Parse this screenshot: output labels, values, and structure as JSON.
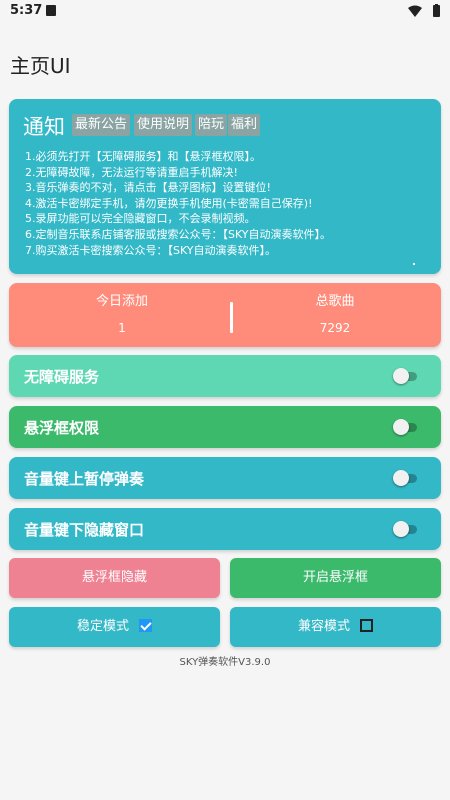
{
  "status_bar": {
    "time": "5:37",
    "icons": [
      "notification-square-icon",
      "wifi-icon",
      "battery-icon"
    ]
  },
  "page": {
    "title": "主页UI"
  },
  "notice": {
    "title": "通知",
    "tags": [
      "最新公告",
      "使用说明",
      "陪玩",
      "福利"
    ],
    "lines": [
      "1.必须先打开【无障碍服务】和【悬浮框权限】。",
      "2.无障碍故障，无法运行等请重启手机解决!",
      "3.音乐弹奏的不对，请点击【悬浮图标】设置键位!",
      "4.激活卡密绑定手机，请勿更换手机使用(卡密需自己保存)!",
      "5.录屏功能可以完全隐藏窗口，不会录制视频。",
      "6.定制音乐联系店铺客服或搜索公众号：【SKY自动演奏软件】。",
      "7.购买激活卡密搜索公众号：【SKY自动演奏软件】。"
    ],
    "color": "#33b8c8"
  },
  "stats": {
    "today_label": "今日添加",
    "today_value": "1",
    "total_label": "总歌曲",
    "total_value": "7292",
    "color": "#ff8b7a"
  },
  "toggles": [
    {
      "label": "无障碍服务",
      "on": false,
      "color": "#5ed8b2"
    },
    {
      "label": "悬浮框权限",
      "on": false,
      "color": "#3cba6c"
    },
    {
      "label": "音量键上暂停弹奏",
      "on": false,
      "color": "#33b8c8"
    },
    {
      "label": "音量键下隐藏窗口",
      "on": false,
      "color": "#33b8c8"
    }
  ],
  "buttons": {
    "hide_float": "悬浮框隐藏",
    "open_float": "开启悬浮框",
    "stable_mode": "稳定模式",
    "stable_checked": true,
    "compat_mode": "兼容模式",
    "compat_checked": false
  },
  "colors": {
    "hide_btn": "#ee8293",
    "open_btn": "#3cba6c",
    "mode_btn": "#33b8c8",
    "checkbox_on": "#2196f3"
  },
  "footer": {
    "version": "SKY弹奏软件V3.9.0"
  }
}
